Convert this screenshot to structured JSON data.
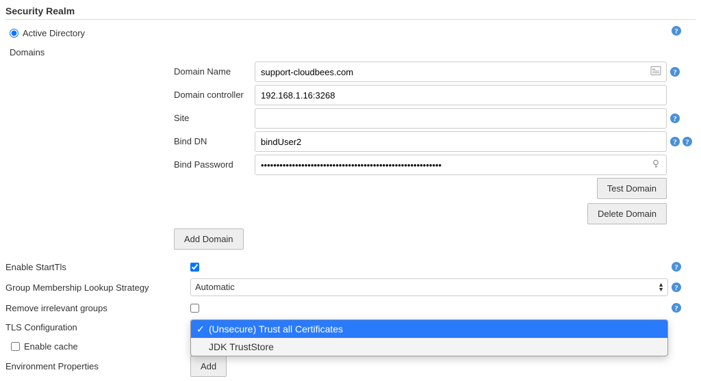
{
  "section_title": "Security Realm",
  "realm": {
    "active_directory_label": "Active Directory",
    "domains_label": "Domains"
  },
  "domain": {
    "name_label": "Domain Name",
    "name_value": "support-cloudbees.com",
    "controller_label": "Domain controller",
    "controller_value": "192.168.1.16:3268",
    "site_label": "Site",
    "site_value": "",
    "bind_dn_label": "Bind DN",
    "bind_dn_value": "bindUser2",
    "bind_password_label": "Bind Password",
    "bind_password_value": "••••••••••••••••••••••••••••••••••••••••••••••••••••••••••"
  },
  "buttons": {
    "test_domain": "Test Domain",
    "delete_domain": "Delete Domain",
    "add_domain": "Add Domain",
    "add": "Add"
  },
  "settings": {
    "enable_starttls_label": "Enable StartTls",
    "group_strategy_label": "Group Membership Lookup Strategy",
    "group_strategy_value": "Automatic",
    "remove_irrelevant_label": "Remove irrelevant groups",
    "tls_config_label": "TLS Configuration",
    "tls_options": [
      "(Unsecure) Trust all Certificates",
      "JDK TrustStore"
    ],
    "tls_selected_index": 0,
    "enable_cache_label": "Enable cache",
    "env_props_label": "Environment Properties"
  }
}
